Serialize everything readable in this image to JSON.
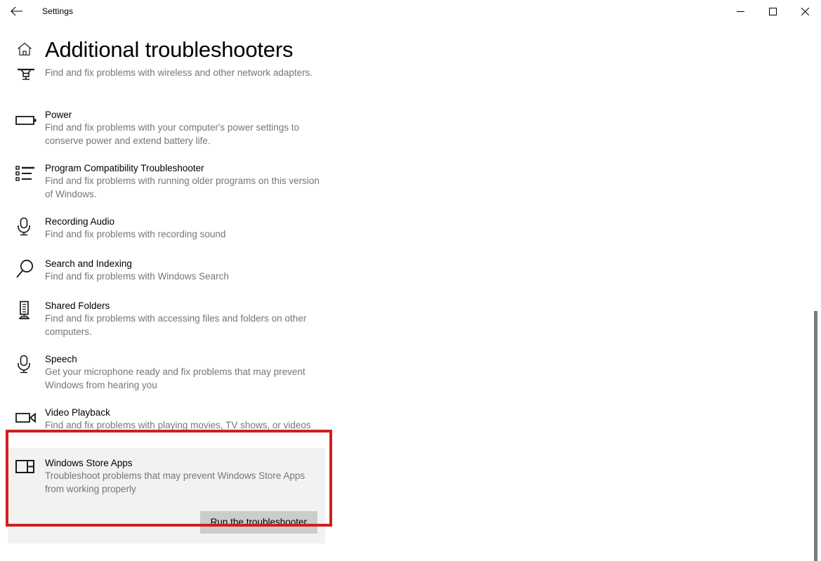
{
  "window": {
    "app_title": "Settings",
    "back_label": "Back",
    "minimize_label": "Minimize",
    "maximize_label": "Maximize",
    "close_label": "Close"
  },
  "header": {
    "home_icon": "home-icon",
    "page_title": "Additional troubleshooters"
  },
  "colors": {
    "accent_annotation": "#d01f1f",
    "card_background": "#f2f2f2",
    "button_background": "#cccccc",
    "description_text": "#767676",
    "scrollbar_thumb": "#7a7a7a"
  },
  "items": [
    {
      "id": "network-adapter",
      "icon": "network-adapter-icon",
      "title": "",
      "description": "Find and fix problems with wireless and other network adapters.",
      "clipped": true
    },
    {
      "id": "power",
      "icon": "battery-icon",
      "title": "Power",
      "description": "Find and fix problems with your computer's power settings to conserve power and extend battery life."
    },
    {
      "id": "program-compatibility-troubleshooter",
      "icon": "list-icon",
      "title": "Program Compatibility Troubleshooter",
      "description": "Find and fix problems with running older programs on this version of Windows."
    },
    {
      "id": "recording-audio",
      "icon": "microphone-icon",
      "title": "Recording Audio",
      "description": "Find and fix problems with recording sound"
    },
    {
      "id": "search-and-indexing",
      "icon": "search-icon",
      "title": "Search and Indexing",
      "description": "Find and fix problems with Windows Search"
    },
    {
      "id": "shared-folders",
      "icon": "server-icon",
      "title": "Shared Folders",
      "description": "Find and fix problems with accessing files and folders on other computers."
    },
    {
      "id": "speech",
      "icon": "microphone-icon",
      "title": "Speech",
      "description": "Get your microphone ready and fix problems that may prevent Windows from hearing you"
    },
    {
      "id": "video-playback",
      "icon": "video-camera-icon",
      "title": "Video Playback",
      "description": "Find and fix problems with playing movies, TV shows, or videos"
    }
  ],
  "selected_item": {
    "id": "windows-store-apps",
    "icon": "window-panes-icon",
    "title": "Windows Store Apps",
    "description": "Troubleshoot problems that may prevent Windows Store Apps from working properly",
    "run_button_label": "Run the troubleshooter"
  }
}
